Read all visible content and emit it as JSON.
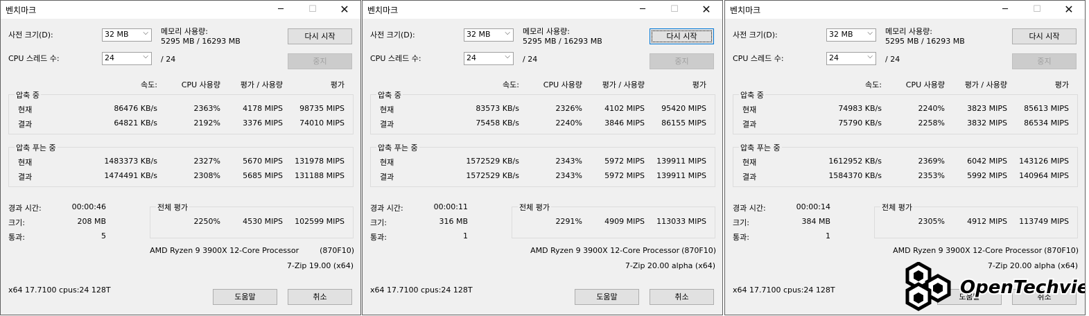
{
  "labels": {
    "window_title": "벤치마크",
    "dict_size": "사전 크기(D):",
    "memory_usage": "메모리 사용량:",
    "threads": "CPU 스레드 수:",
    "restart": "다시 시작",
    "stop": "중지",
    "col_speed": "속도:",
    "col_cpu": "CPU 사용량",
    "col_rating_usage": "평가 / 사용량",
    "col_rating": "평가",
    "compress": "압축 중",
    "decompress": "압축 푸는 중",
    "current": "현재",
    "result": "결과",
    "elapsed": "경과 시간:",
    "size": "크기:",
    "passes": "통과:",
    "total_rating": "전체 평가",
    "help": "도움말",
    "cancel": "취소"
  },
  "windows": [
    {
      "dict_size": "32 MB",
      "memory": "5295 MB / 16293 MB",
      "threads": "24",
      "threads_total": "/ 24",
      "restart_focused": false,
      "compress_current": {
        "speed": "86476 KB/s",
        "cpu": "2363%",
        "rating_usage": "4178 MIPS",
        "rating": "98735 MIPS"
      },
      "compress_result": {
        "speed": "64821 KB/s",
        "cpu": "2192%",
        "rating_usage": "3376 MIPS",
        "rating": "74010 MIPS"
      },
      "decompress_current": {
        "speed": "1483373 KB/s",
        "cpu": "2327%",
        "rating_usage": "5670 MIPS",
        "rating": "131978 MIPS"
      },
      "decompress_result": {
        "speed": "1474491 KB/s",
        "cpu": "2308%",
        "rating_usage": "5685 MIPS",
        "rating": "131188 MIPS"
      },
      "elapsed": "00:00:46",
      "size": "208 MB",
      "passes": "5",
      "total": {
        "cpu": "2250%",
        "rating_usage": "4530 MIPS",
        "rating": "102599 MIPS"
      },
      "cpu_name": "AMD Ryzen 9 3900X 12-Core Processor",
      "cpu_id": "(870F10)",
      "version": "7-Zip 19.00 (x64)",
      "sysinfo": "x64 17.7100 cpus:24 128T"
    },
    {
      "dict_size": "32 MB",
      "memory": "5295 MB / 16293 MB",
      "threads": "24",
      "threads_total": "/ 24",
      "restart_focused": true,
      "compress_current": {
        "speed": "83573 KB/s",
        "cpu": "2326%",
        "rating_usage": "4102 MIPS",
        "rating": "95420 MIPS"
      },
      "compress_result": {
        "speed": "75458 KB/s",
        "cpu": "2240%",
        "rating_usage": "3846 MIPS",
        "rating": "86155 MIPS"
      },
      "decompress_current": {
        "speed": "1572529 KB/s",
        "cpu": "2343%",
        "rating_usage": "5972 MIPS",
        "rating": "139911 MIPS"
      },
      "decompress_result": {
        "speed": "1572529 KB/s",
        "cpu": "2343%",
        "rating_usage": "5972 MIPS",
        "rating": "139911 MIPS"
      },
      "elapsed": "00:00:11",
      "size": "316 MB",
      "passes": "1",
      "total": {
        "cpu": "2291%",
        "rating_usage": "4909 MIPS",
        "rating": "113033 MIPS"
      },
      "cpu_name": "AMD Ryzen 9 3900X 12-Core Processor",
      "cpu_id": "(870F10)",
      "version": "7-Zip 20.00 alpha (x64)",
      "sysinfo": "x64 17.7100 cpus:24 128T"
    },
    {
      "dict_size": "32 MB",
      "memory": "5295 MB / 16293 MB",
      "threads": "24",
      "threads_total": "/ 24",
      "restart_focused": false,
      "compress_current": {
        "speed": "74983 KB/s",
        "cpu": "2240%",
        "rating_usage": "3823 MIPS",
        "rating": "85613 MIPS"
      },
      "compress_result": {
        "speed": "75790 KB/s",
        "cpu": "2258%",
        "rating_usage": "3832 MIPS",
        "rating": "86534 MIPS"
      },
      "decompress_current": {
        "speed": "1612952 KB/s",
        "cpu": "2369%",
        "rating_usage": "6042 MIPS",
        "rating": "143126 MIPS"
      },
      "decompress_result": {
        "speed": "1584370 KB/s",
        "cpu": "2353%",
        "rating_usage": "5992 MIPS",
        "rating": "140964 MIPS"
      },
      "elapsed": "00:00:14",
      "size": "384 MB",
      "passes": "1",
      "total": {
        "cpu": "2305%",
        "rating_usage": "4912 MIPS",
        "rating": "113749 MIPS"
      },
      "cpu_name": "AMD Ryzen 9 3900X 12-Core Processor",
      "cpu_id": "(870F10)",
      "version": "7-Zip 20.00 alpha (x64)",
      "sysinfo": "x64 17.7100 cpus:24 128T"
    }
  ],
  "watermark": {
    "text": "OpenTechview"
  }
}
